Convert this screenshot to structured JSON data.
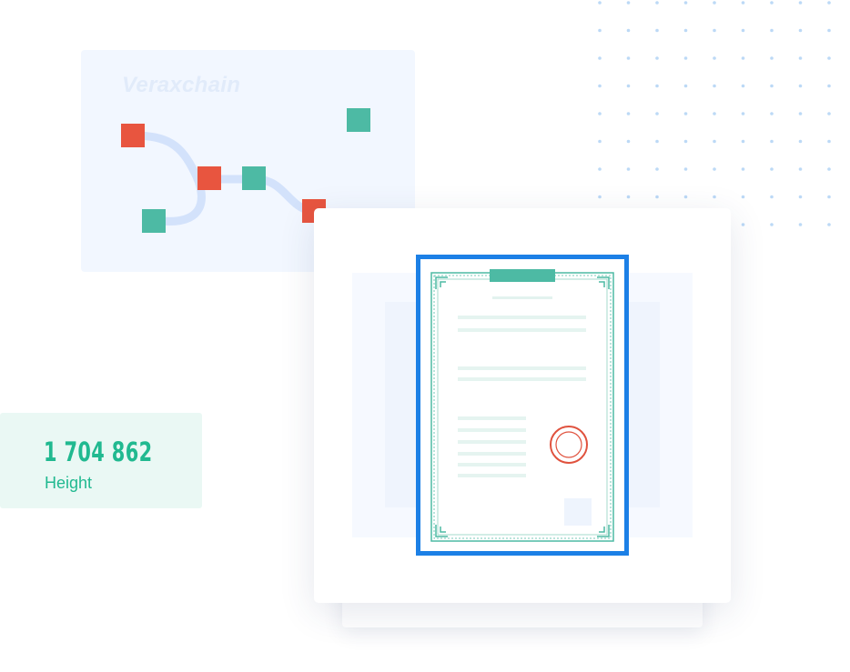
{
  "chain_panel": {
    "brand": "Veraxchain",
    "colors": {
      "node_red": "#e8553f",
      "node_teal": "#4dbaa4",
      "connector": "#d3e2fb",
      "panel": "#f2f7ff"
    }
  },
  "height_card": {
    "value": "1 704 862",
    "label": "Height",
    "color": "#21b990"
  },
  "certificate": {
    "frame_color": "#1c80e6",
    "ornament_color": "#4dbaa4",
    "seal_color": "#e0523e",
    "icons": [
      "document-icon",
      "seal-icon",
      "qr-icon"
    ]
  }
}
